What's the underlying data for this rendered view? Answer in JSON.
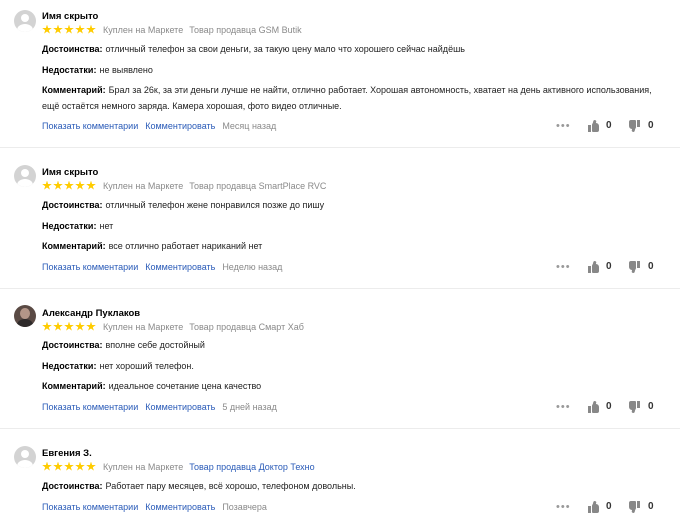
{
  "labels": {
    "pros": "Достоинства:",
    "cons": "Недостатки:",
    "comment": "Комментарий:",
    "show_comments": "Показать комментарии",
    "do_comment": "Комментировать",
    "more": "•••"
  },
  "reviews": [
    {
      "author": "Имя скрыто",
      "avatar": "placeholder",
      "rating": 5,
      "purchased": "Куплен на Маркете",
      "seller": "Товар продавца GSM Butik",
      "pros": "отличный телефон за свои деньги, за такую цену мало что хорошего сейчас найдёшь",
      "cons": "не выявлено",
      "comment": "Брал за 26к, за эти деньги лучше не найти, отлично работает. Хорошая автономность, хватает на день активного использования, ещё остаётся немного заряда. Камера хорошая, фото видео отличные.",
      "date": "Месяц назад",
      "likes": "0",
      "dislikes": "0"
    },
    {
      "author": "Имя скрыто",
      "avatar": "placeholder",
      "rating": 5,
      "purchased": "Куплен на Маркете",
      "seller": "Товар продавца SmartPlace RVC",
      "pros": "отличный телефон жене понравился позже до пишу",
      "cons": "нет",
      "comment": "все отлично работает нариканий нет",
      "date": "Неделю назад",
      "likes": "0",
      "dislikes": "0"
    },
    {
      "author": "Александр Пуклаков",
      "avatar": "photo",
      "rating": 5,
      "purchased": "Куплен на Маркете",
      "seller": "Товар продавца Смарт Хаб",
      "pros": "вполне себе достойный",
      "cons": "нет хороший телефон.",
      "comment": "идеальное сочетание цена качество",
      "date": "5 дней назад",
      "likes": "0",
      "dislikes": "0"
    },
    {
      "author": "Евгения З.",
      "avatar": "placeholder",
      "rating": 5,
      "purchased": "Куплен на Маркете",
      "seller": "Товар продавца Доктор Техно",
      "seller_is_link": true,
      "pros": "Работает пару месяцев, всё хорошо, телефоном довольны.",
      "date": "Позавчера",
      "likes": "0",
      "dislikes": "0"
    }
  ],
  "colors": {
    "link": "#2a5bb8",
    "muted": "#8a8a8a",
    "star": "#ffcc00"
  }
}
